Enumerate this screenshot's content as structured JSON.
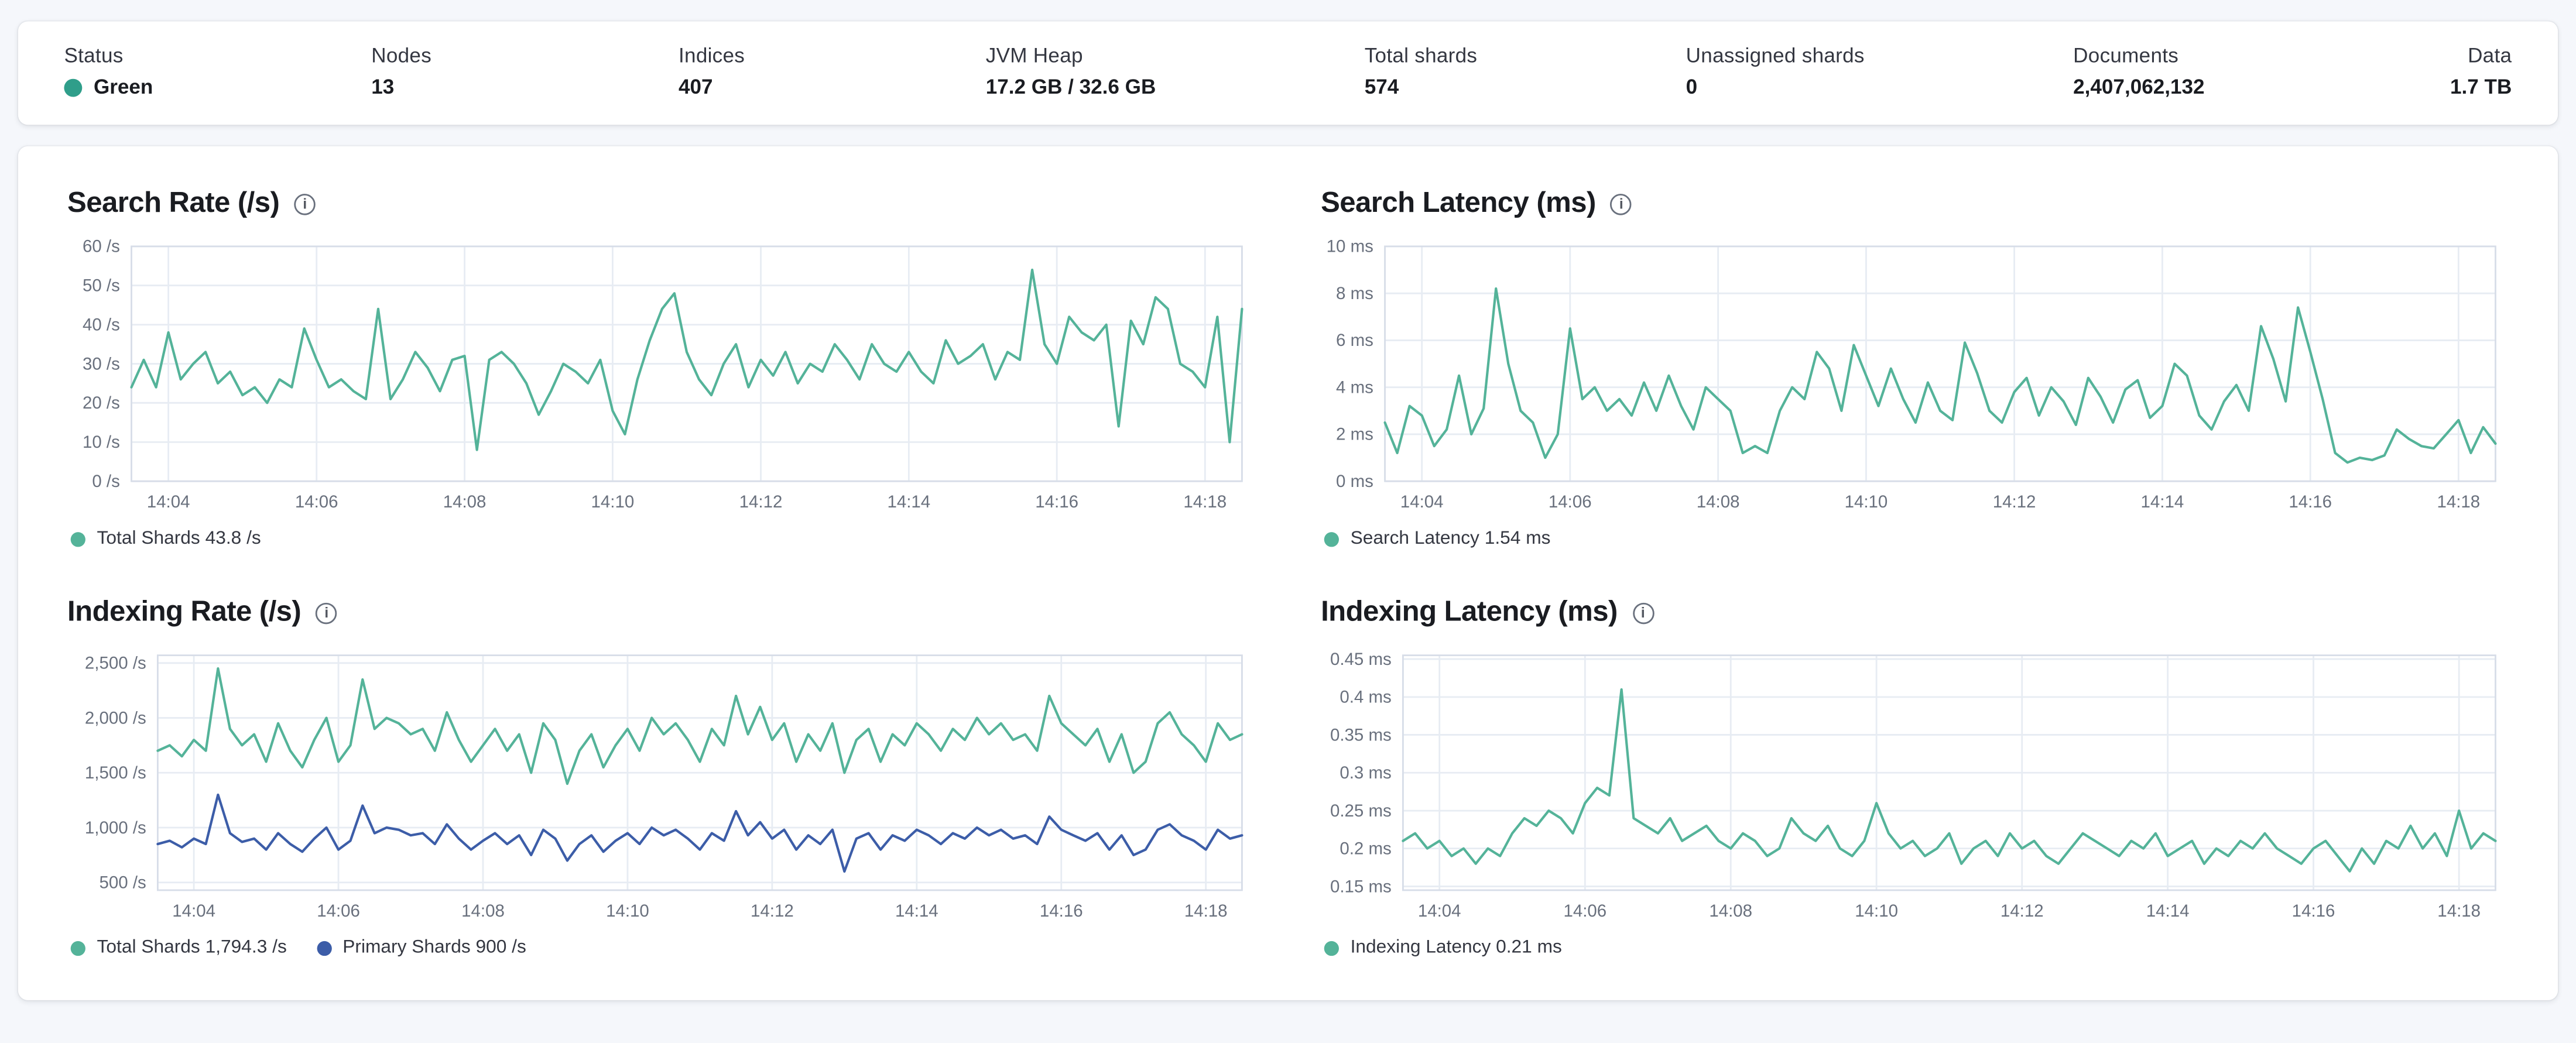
{
  "overview": {
    "stats": [
      {
        "label": "Status",
        "value": "Green",
        "dot_color": "#2f9e8a"
      },
      {
        "label": "Nodes",
        "value": "13"
      },
      {
        "label": "Indices",
        "value": "407"
      },
      {
        "label": "JVM Heap",
        "value": "17.2 GB / 32.6 GB"
      },
      {
        "label": "Total shards",
        "value": "574"
      },
      {
        "label": "Unassigned shards",
        "value": "0"
      },
      {
        "label": "Documents",
        "value": "2,407,062,132"
      },
      {
        "label": "Data",
        "value": "1.7 TB"
      }
    ]
  },
  "colors": {
    "teal": "#54b399",
    "blue": "#3c5da8",
    "grid": "#e7ecf3",
    "axis_text": "#69707d"
  },
  "chart_data": [
    {
      "id": "search-rate",
      "type": "line",
      "title": "Search Rate (/s)",
      "ylim": [
        0,
        60
      ],
      "yticks": [
        {
          "v": 60,
          "l": "60 /s"
        },
        {
          "v": 50,
          "l": "50 /s"
        },
        {
          "v": 40,
          "l": "40 /s"
        },
        {
          "v": 30,
          "l": "30 /s"
        },
        {
          "v": 20,
          "l": "20 /s"
        },
        {
          "v": 10,
          "l": "10 /s"
        },
        {
          "v": 0,
          "l": "0 /s"
        }
      ],
      "xticks": [
        {
          "p": 3,
          "l": "14:04"
        },
        {
          "p": 15,
          "l": "14:06"
        },
        {
          "p": 27,
          "l": "14:08"
        },
        {
          "p": 39,
          "l": "14:10"
        },
        {
          "p": 51,
          "l": "14:12"
        },
        {
          "p": 63,
          "l": "14:14"
        },
        {
          "p": 75,
          "l": "14:16"
        },
        {
          "p": 87,
          "l": "14:18"
        }
      ],
      "legend": [
        {
          "label": "Total Shards 43.8 /s",
          "color": "#54b399"
        }
      ],
      "series": [
        {
          "name": "Total Shards",
          "color": "#54b399",
          "values": [
            24,
            31,
            24,
            38,
            26,
            30,
            33,
            25,
            28,
            22,
            24,
            20,
            26,
            24,
            39,
            31,
            24,
            26,
            23,
            21,
            44,
            21,
            26,
            33,
            29,
            23,
            31,
            32,
            8,
            31,
            33,
            30,
            25,
            17,
            23,
            30,
            28,
            25,
            31,
            18,
            12,
            26,
            36,
            44,
            48,
            33,
            26,
            22,
            30,
            35,
            24,
            31,
            27,
            33,
            25,
            30,
            28,
            35,
            31,
            26,
            35,
            30,
            28,
            33,
            28,
            25,
            36,
            30,
            32,
            35,
            26,
            33,
            31,
            54,
            35,
            30,
            42,
            38,
            36,
            40,
            14,
            41,
            35,
            47,
            44,
            30,
            28,
            24,
            42,
            10,
            44
          ]
        }
      ]
    },
    {
      "id": "search-latency",
      "type": "line",
      "title": "Search Latency (ms)",
      "ylim": [
        0,
        10
      ],
      "yticks": [
        {
          "v": 10,
          "l": "10 ms"
        },
        {
          "v": 8,
          "l": "8 ms"
        },
        {
          "v": 6,
          "l": "6 ms"
        },
        {
          "v": 4,
          "l": "4 ms"
        },
        {
          "v": 2,
          "l": "2 ms"
        },
        {
          "v": 0,
          "l": "0 ms"
        }
      ],
      "xticks": [
        {
          "p": 3,
          "l": "14:04"
        },
        {
          "p": 15,
          "l": "14:06"
        },
        {
          "p": 27,
          "l": "14:08"
        },
        {
          "p": 39,
          "l": "14:10"
        },
        {
          "p": 51,
          "l": "14:12"
        },
        {
          "p": 63,
          "l": "14:14"
        },
        {
          "p": 75,
          "l": "14:16"
        },
        {
          "p": 87,
          "l": "14:18"
        }
      ],
      "legend": [
        {
          "label": "Search Latency 1.54 ms",
          "color": "#54b399"
        }
      ],
      "series": [
        {
          "name": "Search Latency",
          "color": "#54b399",
          "values": [
            2.5,
            1.2,
            3.2,
            2.8,
            1.5,
            2.2,
            4.5,
            2.0,
            3.1,
            8.2,
            5.0,
            3.0,
            2.5,
            1.0,
            2.0,
            6.5,
            3.5,
            4.0,
            3.0,
            3.5,
            2.8,
            4.2,
            3.0,
            4.5,
            3.2,
            2.2,
            4.0,
            3.5,
            3.0,
            1.2,
            1.5,
            1.2,
            3.0,
            4.0,
            3.5,
            5.5,
            4.8,
            3.0,
            5.8,
            4.5,
            3.2,
            4.8,
            3.5,
            2.5,
            4.2,
            3.0,
            2.6,
            5.9,
            4.6,
            3.0,
            2.5,
            3.8,
            4.4,
            2.8,
            4.0,
            3.4,
            2.4,
            4.4,
            3.6,
            2.5,
            3.9,
            4.3,
            2.7,
            3.2,
            5.0,
            4.5,
            2.8,
            2.2,
            3.4,
            4.1,
            3.0,
            6.6,
            5.2,
            3.4,
            7.4,
            5.5,
            3.5,
            1.2,
            0.8,
            1.0,
            0.9,
            1.1,
            2.2,
            1.8,
            1.5,
            1.4,
            2.0,
            2.6,
            1.2,
            2.3,
            1.6
          ]
        }
      ]
    },
    {
      "id": "indexing-rate",
      "type": "line",
      "title": "Indexing Rate (/s)",
      "ylim": [
        430,
        2570
      ],
      "yticks": [
        {
          "v": 2500,
          "l": "2,500 /s"
        },
        {
          "v": 2000,
          "l": "2,000 /s"
        },
        {
          "v": 1500,
          "l": "1,500 /s"
        },
        {
          "v": 1000,
          "l": "1,000 /s"
        },
        {
          "v": 500,
          "l": "500 /s"
        }
      ],
      "xticks": [
        {
          "p": 3,
          "l": "14:04"
        },
        {
          "p": 15,
          "l": "14:06"
        },
        {
          "p": 27,
          "l": "14:08"
        },
        {
          "p": 39,
          "l": "14:10"
        },
        {
          "p": 51,
          "l": "14:12"
        },
        {
          "p": 63,
          "l": "14:14"
        },
        {
          "p": 75,
          "l": "14:16"
        },
        {
          "p": 87,
          "l": "14:18"
        }
      ],
      "legend": [
        {
          "label": "Total Shards 1,794.3 /s",
          "color": "#54b399"
        },
        {
          "label": "Primary Shards 900 /s",
          "color": "#3c5da8"
        }
      ],
      "series": [
        {
          "name": "Total Shards",
          "color": "#54b399",
          "values": [
            1700,
            1750,
            1650,
            1800,
            1700,
            2450,
            1900,
            1750,
            1850,
            1600,
            1950,
            1700,
            1550,
            1800,
            2000,
            1600,
            1750,
            2350,
            1900,
            2000,
            1950,
            1850,
            1900,
            1700,
            2050,
            1800,
            1600,
            1750,
            1900,
            1700,
            1850,
            1500,
            1950,
            1800,
            1400,
            1700,
            1850,
            1550,
            1750,
            1900,
            1700,
            2000,
            1850,
            1950,
            1800,
            1600,
            1900,
            1750,
            2200,
            1850,
            2100,
            1800,
            1950,
            1600,
            1850,
            1700,
            1950,
            1500,
            1800,
            1900,
            1600,
            1850,
            1750,
            1950,
            1850,
            1700,
            1900,
            1800,
            2000,
            1850,
            1950,
            1800,
            1850,
            1700,
            2200,
            1950,
            1850,
            1750,
            1900,
            1600,
            1850,
            1500,
            1600,
            1950,
            2050,
            1850,
            1750,
            1600,
            1950,
            1800,
            1850
          ]
        },
        {
          "name": "Primary Shards",
          "color": "#3c5da8",
          "values": [
            850,
            880,
            820,
            900,
            850,
            1300,
            950,
            870,
            900,
            800,
            950,
            850,
            780,
            900,
            1000,
            800,
            880,
            1200,
            950,
            1000,
            980,
            930,
            950,
            850,
            1030,
            900,
            800,
            880,
            950,
            850,
            930,
            750,
            980,
            900,
            700,
            850,
            930,
            780,
            880,
            950,
            850,
            1000,
            930,
            980,
            900,
            800,
            950,
            880,
            1150,
            930,
            1050,
            900,
            980,
            800,
            930,
            850,
            980,
            600,
            900,
            950,
            800,
            930,
            880,
            980,
            930,
            850,
            950,
            900,
            1000,
            930,
            980,
            900,
            930,
            850,
            1100,
            980,
            930,
            880,
            950,
            800,
            930,
            750,
            800,
            980,
            1030,
            930,
            880,
            800,
            980,
            900,
            930
          ]
        }
      ]
    },
    {
      "id": "indexing-latency",
      "type": "line",
      "title": "Indexing Latency (ms)",
      "ylim": [
        0.145,
        0.455
      ],
      "yticks": [
        {
          "v": 0.45,
          "l": "0.45 ms"
        },
        {
          "v": 0.4,
          "l": "0.4 ms"
        },
        {
          "v": 0.35,
          "l": "0.35 ms"
        },
        {
          "v": 0.3,
          "l": "0.3 ms"
        },
        {
          "v": 0.25,
          "l": "0.25 ms"
        },
        {
          "v": 0.2,
          "l": "0.2 ms"
        },
        {
          "v": 0.15,
          "l": "0.15 ms"
        }
      ],
      "xticks": [
        {
          "p": 3,
          "l": "14:04"
        },
        {
          "p": 15,
          "l": "14:06"
        },
        {
          "p": 27,
          "l": "14:08"
        },
        {
          "p": 39,
          "l": "14:10"
        },
        {
          "p": 51,
          "l": "14:12"
        },
        {
          "p": 63,
          "l": "14:14"
        },
        {
          "p": 75,
          "l": "14:16"
        },
        {
          "p": 87,
          "l": "14:18"
        }
      ],
      "legend": [
        {
          "label": "Indexing Latency 0.21 ms",
          "color": "#54b399"
        }
      ],
      "series": [
        {
          "name": "Indexing Latency",
          "color": "#54b399",
          "values": [
            0.21,
            0.22,
            0.2,
            0.21,
            0.19,
            0.2,
            0.18,
            0.2,
            0.19,
            0.22,
            0.24,
            0.23,
            0.25,
            0.24,
            0.22,
            0.26,
            0.28,
            0.27,
            0.41,
            0.24,
            0.23,
            0.22,
            0.24,
            0.21,
            0.22,
            0.23,
            0.21,
            0.2,
            0.22,
            0.21,
            0.19,
            0.2,
            0.24,
            0.22,
            0.21,
            0.23,
            0.2,
            0.19,
            0.21,
            0.26,
            0.22,
            0.2,
            0.21,
            0.19,
            0.2,
            0.22,
            0.18,
            0.2,
            0.21,
            0.19,
            0.22,
            0.2,
            0.21,
            0.19,
            0.18,
            0.2,
            0.22,
            0.21,
            0.2,
            0.19,
            0.21,
            0.2,
            0.22,
            0.19,
            0.2,
            0.21,
            0.18,
            0.2,
            0.19,
            0.21,
            0.2,
            0.22,
            0.2,
            0.19,
            0.18,
            0.2,
            0.21,
            0.19,
            0.17,
            0.2,
            0.18,
            0.21,
            0.2,
            0.23,
            0.2,
            0.22,
            0.19,
            0.25,
            0.2,
            0.22,
            0.21
          ]
        }
      ]
    }
  ]
}
